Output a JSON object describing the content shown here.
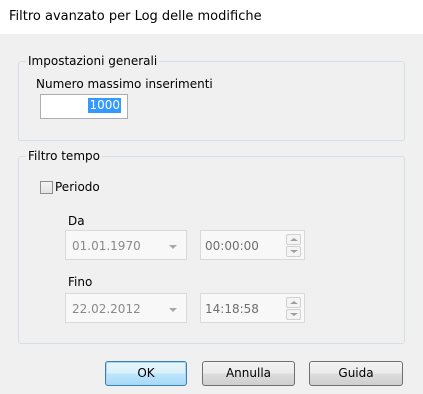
{
  "window": {
    "title": "Filtro avanzato per Log delle modifiche"
  },
  "general": {
    "group_label": "Impostazioni generali",
    "max_entries_label": "Numero massimo inserimenti",
    "max_entries_value": "1000"
  },
  "time_filter": {
    "group_label": "Filtro tempo",
    "period_label": "Periodo",
    "period_checked": false,
    "from_label": "Da",
    "from_date": "01.01.1970",
    "from_time": "00:00:00",
    "to_label": "Fino",
    "to_date": "22.02.2012",
    "to_time": "14:18:58"
  },
  "buttons": {
    "ok": "OK",
    "cancel": "Annulla",
    "help": "Guida"
  },
  "icons": {
    "combo_arrow": "chevron-down-icon",
    "spin_up": "spin-up-icon",
    "spin_down": "spin-down-icon"
  }
}
